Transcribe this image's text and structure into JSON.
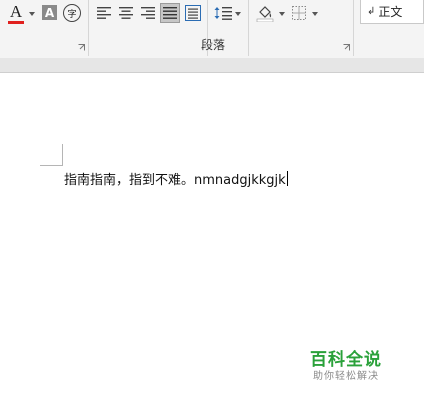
{
  "ribbon": {
    "font_color_letter": "A",
    "shade_letter": "A",
    "enclose_letter": "字",
    "paragraph_group_label": "段落",
    "style_gallery_item": "正文",
    "style_gallery_mark": "↲",
    "font_color": "#e0201e",
    "selected_align": "justify"
  },
  "document": {
    "text": "指南指南，指到不难。nmnadgjkkgjk"
  },
  "watermark": {
    "title": "百科全说",
    "subtitle": "助你轻松解决"
  }
}
